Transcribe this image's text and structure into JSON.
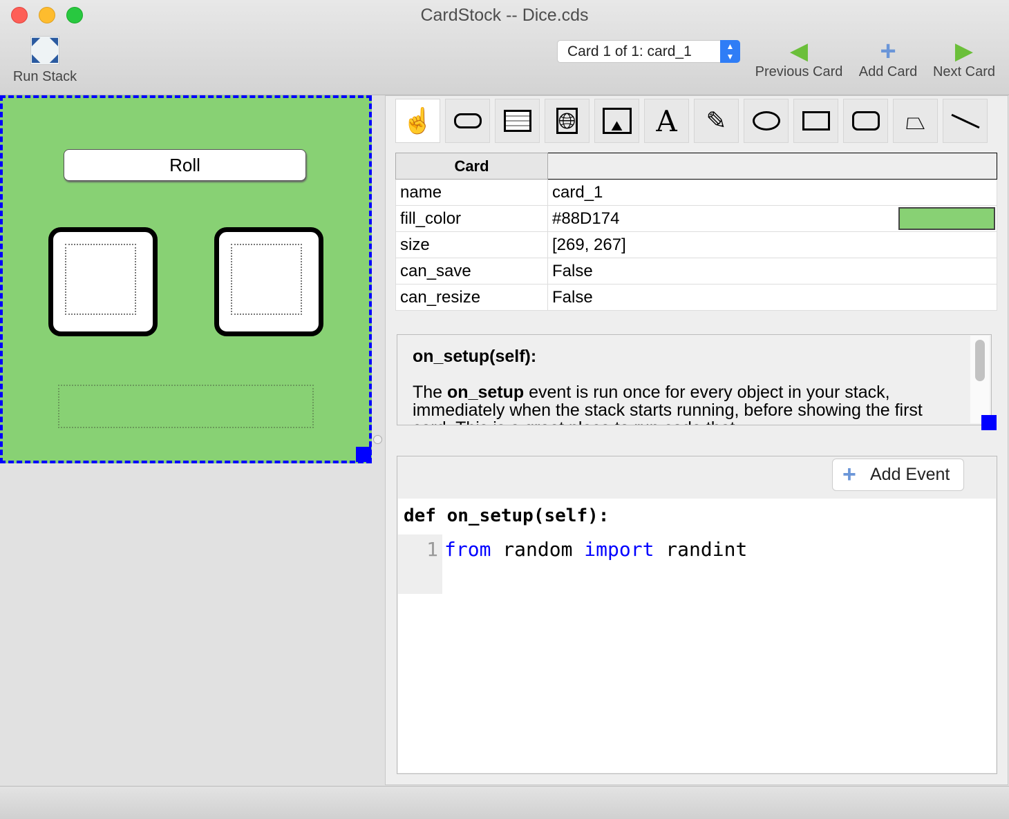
{
  "window": {
    "title": "CardStock -- Dice.cds"
  },
  "toolbar": {
    "run_stack": "Run Stack",
    "card_selector": "Card 1 of 1: card_1",
    "previous_card": "Previous Card",
    "add_card": "Add Card",
    "next_card": "Next Card"
  },
  "card": {
    "fill_color": "#88D174",
    "roll_button": "Roll"
  },
  "tools": [
    "hand",
    "button",
    "text-field",
    "web-view",
    "image",
    "text-label",
    "pen",
    "oval",
    "rectangle",
    "rounded-rectangle",
    "polygon",
    "line"
  ],
  "properties": {
    "header": "Card",
    "rows": [
      {
        "key": "name",
        "value": "card_1"
      },
      {
        "key": "fill_color",
        "value": "#88D174"
      },
      {
        "key": "size",
        "value": "[269, 267]"
      },
      {
        "key": "can_save",
        "value": "False"
      },
      {
        "key": "can_resize",
        "value": "False"
      }
    ]
  },
  "help": {
    "title": "on_setup(self):",
    "pre": "The ",
    "bold": "on_setup",
    "post": " event is run once for every object in your stack, immediately when the stack starts running, before showing the first card. This is a great place to run code that"
  },
  "events": {
    "add_event": "Add Event",
    "signature": "def on_setup(self):",
    "line_number": "1",
    "kw_from": "from",
    "module": " random ",
    "kw_import": "import",
    "name": " randint"
  }
}
